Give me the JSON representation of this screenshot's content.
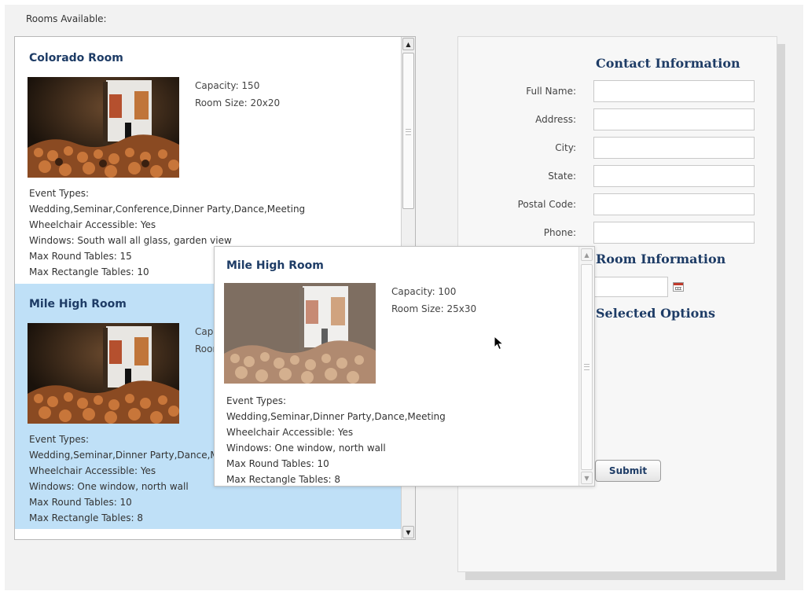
{
  "rooms_label": "Rooms Available:",
  "rooms": [
    {
      "name": "Colorado Room",
      "capacity": "Capacity: 150",
      "room_size": "Room Size: 20x20",
      "details": [
        "Event Types:",
        "Wedding,Seminar,Conference,Dinner Party,Dance,Meeting",
        "Wheelchair Accessible: Yes",
        "Windows: South wall all glass, garden view",
        "Max Round Tables: 15",
        "Max Rectangle Tables: 10"
      ]
    },
    {
      "name": "Mile High Room",
      "capacity": "Capacity: 100",
      "room_size": "Room Size: 25x30",
      "details": [
        "Event Types:",
        "Wedding,Seminar,Dinner Party,Dance,Meeting",
        "Wheelchair Accessible: Yes",
        "Windows: One window, north wall",
        "Max Round Tables: 10",
        "Max Rectangle Tables: 8"
      ]
    }
  ],
  "selected_room_index": 1,
  "contact": {
    "heading": "Contact Information",
    "fields": [
      {
        "label": "Full Name:",
        "value": ""
      },
      {
        "label": "Address:",
        "value": ""
      },
      {
        "label": "City:",
        "value": ""
      },
      {
        "label": "State:",
        "value": ""
      },
      {
        "label": "Postal Code:",
        "value": ""
      },
      {
        "label": "Phone:",
        "value": ""
      }
    ],
    "room_info_heading": "Room Information",
    "date_value": "",
    "selected_options_heading": "Selected Options",
    "submit_label": "Submit"
  },
  "icons": {
    "scroll_up": "scroll-up-arrow-icon",
    "scroll_down": "scroll-down-arrow-icon",
    "calendar": "calendar-icon",
    "cursor": "mouse-pointer-icon"
  },
  "colors": {
    "selected_row": "#bfe0f7",
    "heading": "#1e3c66"
  }
}
